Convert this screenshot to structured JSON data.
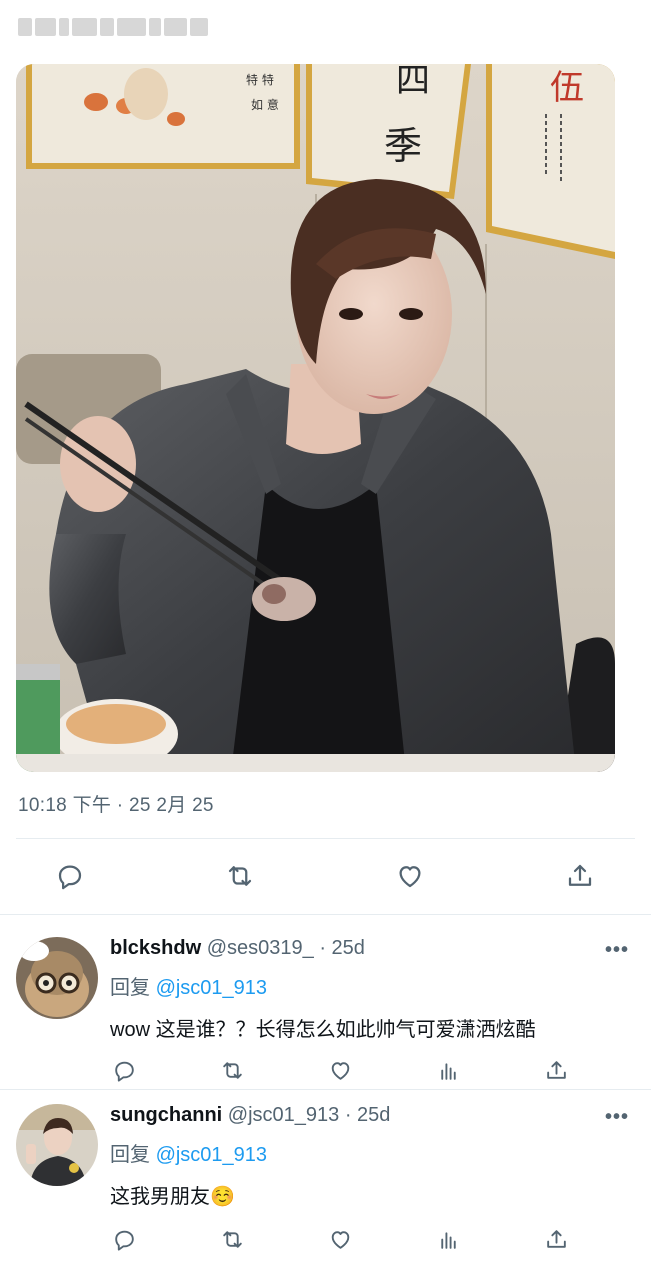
{
  "post": {
    "timestamp": "10:18 下午 · 25 2月 25",
    "image": "photo of a man in a grey denim jacket holding chopsticks with food, framed calligraphy art on the wall behind",
    "actions": [
      "reply-icon",
      "retweet-icon",
      "like-icon",
      "share-icon"
    ]
  },
  "replies": [
    {
      "name": "blckshdw",
      "handle": "@ses0319_",
      "time": "· 25d",
      "reply_prefix": "回复 ",
      "reply_to": "@jsc01_913",
      "text": "wow 这是谁？？长得怎么如此帅气可爱潇洒炫酷",
      "more": "•••",
      "avatar": "cat-with-glasses-avatar"
    },
    {
      "name": "sungchanni",
      "handle": "@jsc01_913",
      "time": "· 25d",
      "reply_prefix": "回复 ",
      "reply_to": "@jsc01_913",
      "text": "这我男朋友☺️",
      "more": "•••",
      "avatar": "person-photo-avatar"
    }
  ],
  "colors": {
    "text": "#0f1419",
    "secondary": "#536471",
    "link": "#1d9bf0",
    "divider": "#e6ecf0"
  }
}
